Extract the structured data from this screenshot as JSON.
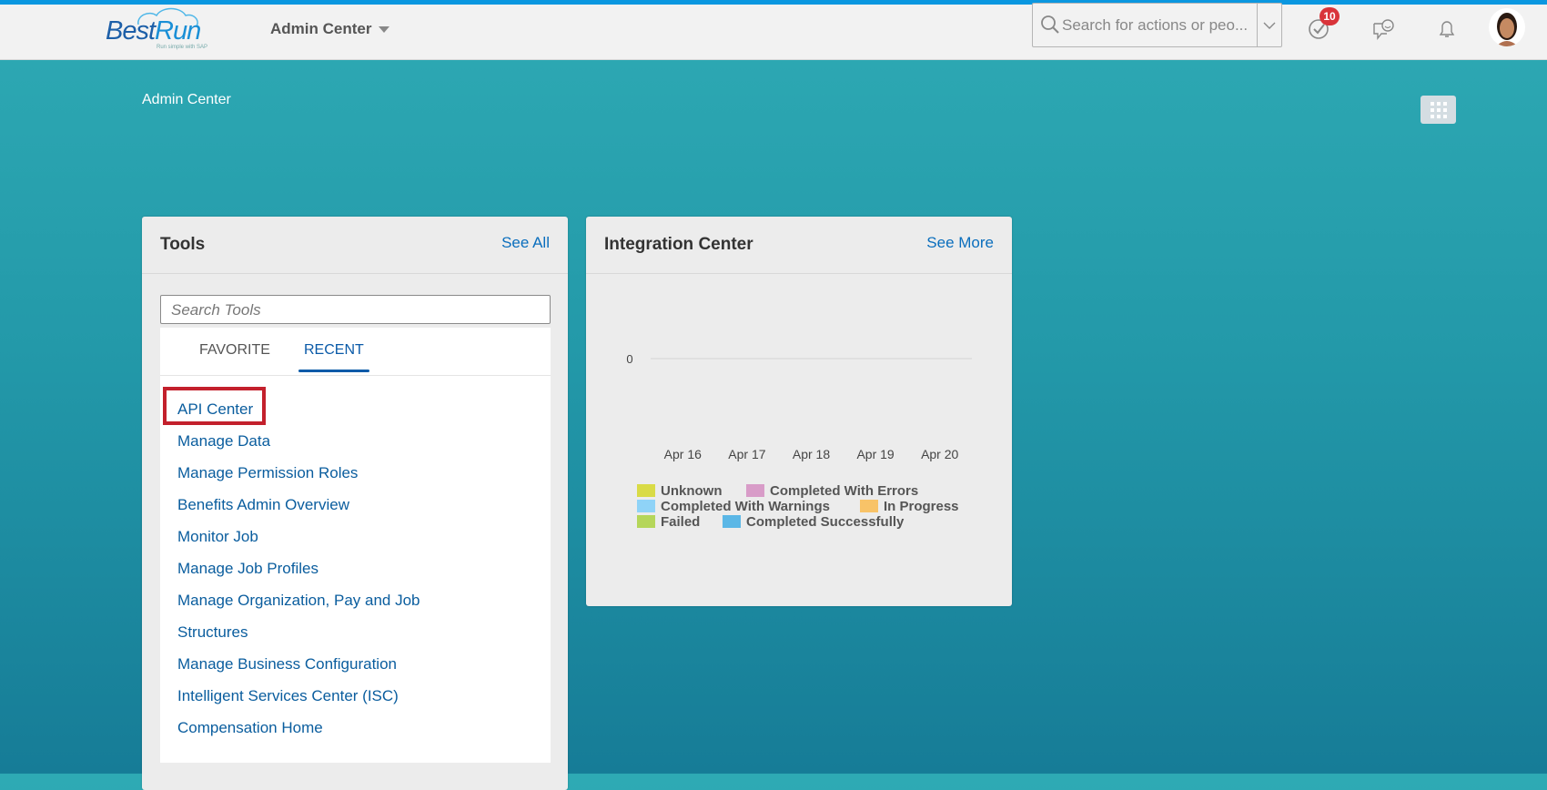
{
  "header": {
    "logo_text_a": "Best",
    "logo_text_b": "Run",
    "logo_tagline": "Run simple with SAP",
    "app_title": "Admin Center",
    "search_placeholder": "Search for actions or peo...",
    "todo_badge": "10",
    "icons": [
      "search-icon",
      "chevron-down-icon",
      "check-circle-icon",
      "chat-smiley-icon",
      "bell-icon",
      "avatar"
    ]
  },
  "page": {
    "breadcrumb": "Admin Center"
  },
  "tools": {
    "title": "Tools",
    "see_all": "See All",
    "search_placeholder": "Search Tools",
    "tabs": [
      {
        "label": "FAVORITE"
      },
      {
        "label": "RECENT",
        "active": true
      }
    ],
    "items": [
      "API Center",
      "Manage Data",
      "Manage Permission Roles",
      "Benefits Admin Overview",
      "Monitor Job",
      "Manage Job Profiles",
      "Manage Organization, Pay and Job",
      "Structures",
      "Manage Business Configuration",
      "Intelligent Services Center (ISC)",
      "Compensation Home"
    ],
    "highlighted_item": "API Center"
  },
  "integration": {
    "title": "Integration Center",
    "see_more": "See More"
  },
  "chart_data": {
    "type": "bar",
    "title": "",
    "categories": [
      "Apr 16",
      "Apr 17",
      "Apr 18",
      "Apr 19",
      "Apr 20"
    ],
    "y_ticks": [
      "0"
    ],
    "ylim": [
      0,
      0
    ],
    "series": [
      {
        "name": "Unknown",
        "color": "#d9db46",
        "values": [
          0,
          0,
          0,
          0,
          0
        ]
      },
      {
        "name": "Completed With Errors",
        "color": "#d89cc8",
        "values": [
          0,
          0,
          0,
          0,
          0
        ]
      },
      {
        "name": "Completed With Warnings",
        "color": "#8fd3f7",
        "values": [
          0,
          0,
          0,
          0,
          0
        ]
      },
      {
        "name": "In Progress",
        "color": "#f8c368",
        "values": [
          0,
          0,
          0,
          0,
          0
        ]
      },
      {
        "name": "Failed",
        "color": "#b5d65a",
        "values": [
          0,
          0,
          0,
          0,
          0
        ]
      },
      {
        "name": "Completed Successfully",
        "color": "#5bb7e6",
        "values": [
          0,
          0,
          0,
          0,
          0
        ]
      }
    ],
    "legend": "bottom"
  },
  "colors": {
    "accent": "#0a5aa8",
    "link": "#0a6ebd",
    "highlight_box": "#c3202c",
    "badge": "#d9343a"
  }
}
